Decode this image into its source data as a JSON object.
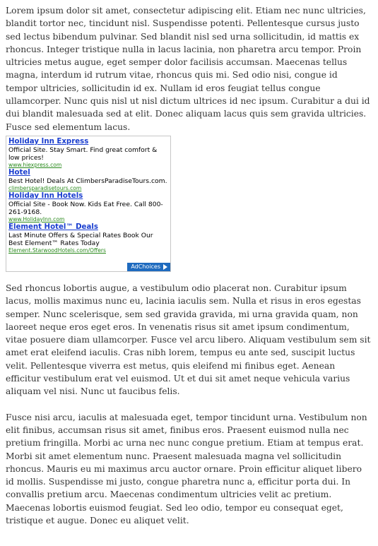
{
  "article": {
    "para1": "Lorem ipsum dolor sit amet, consectetur adipiscing elit. Etiam nec nunc ultricies, blandit tortor nec, tincidunt nisl. Suspendisse potenti. Pellentesque cursus justo sed lectus bibendum pulvinar. Sed blandit nisl sed urna sollicitudin, id mattis ex rhoncus. Integer tristique nulla in lacus lacinia, non pharetra arcu tempor. Proin ultricies metus augue, eget semper dolor facilisis accumsan. Maecenas tellus magna, interdum id rutrum vitae, rhoncus quis mi. Sed odio nisi, congue id tempor ultricies, sollicitudin id ex. Nullam id eros feugiat tellus congue ullamcorper. Nunc quis nisl ut nisl dictum ultrices id nec ipsum. Curabitur a dui id dui blandit malesuada sed at elit. Donec aliquam lacus quis sem gravida ultricies. Fusce sed elementum lacus.",
    "para2": "Sed rhoncus lobortis augue, a vestibulum odio placerat non. Curabitur ipsum lacus, mollis maximus nunc eu, lacinia iaculis sem. Nulla et risus in eros egestas semper. Nunc scelerisque, sem sed gravida gravida, mi urna gravida quam, non laoreet neque eros eget eros. In venenatis risus sit amet ipsum condimentum, vitae posuere diam ullamcorper. Fusce vel arcu libero. Aliquam vestibulum sem sit amet erat eleifend iaculis. Cras nibh lorem, tempus eu ante sed, suscipit luctus velit. Pellentesque viverra est metus, quis eleifend mi finibus eget. Aenean efficitur vestibulum erat vel euismod. Ut et dui sit amet neque vehicula varius aliquam vel nisi. Nunc ut faucibus felis.",
    "para3": "Fusce nisi arcu, iaculis at malesuada eget, tempor tincidunt urna. Vestibulum non elit finibus, accumsan risus sit amet, finibus eros. Praesent euismod nulla nec pretium fringilla. Morbi ac urna nec nunc congue pretium. Etiam at tempus erat. Morbi sit amet elementum nunc. Praesent malesuada magna vel sollicitudin rhoncus. Mauris eu mi maximus arcu auctor ornare. Proin efficitur aliquet libero id mollis. Suspendisse mi justo, congue pharetra nunc a, efficitur porta dui. In convallis pretium arcu. Maecenas condimentum ultricies velit ac pretium. Maecenas lobortis euismod feugiat. Sed leo odio, tempor eu consequat eget, tristique et augue. Donec eu aliquet velit."
  },
  "ads": [
    {
      "title": "Holiday Inn Express",
      "desc": "Official Site. Stay Smart. Find great comfort & low prices!",
      "url": "www.hiexpress.com"
    },
    {
      "title": "Hotel",
      "desc": "Best Hotel! Deals At ClimbersParadiseTours.com.",
      "url": "climbersparadisetours.com"
    },
    {
      "title": "Holiday Inn Hotels",
      "desc": "Official Site - Book Now. Kids Eat Free. Call 800-261-9168.",
      "url": "www.HolidayInn.com"
    },
    {
      "title": "Element Hotel™ Deals",
      "desc": "Last Minute Offers & Special Rates Book Our Best Element™ Rates Today",
      "url": "Element.StarwoodHotels.com/Offers"
    }
  ],
  "adchoices": {
    "label": "AdChoices",
    "icon": "adchoices-triangle-icon",
    "bg_color": "#1f6bbf"
  },
  "colors": {
    "text": "#333333",
    "ad_title": "#1a3ecf",
    "ad_url": "#2a8a1c"
  }
}
